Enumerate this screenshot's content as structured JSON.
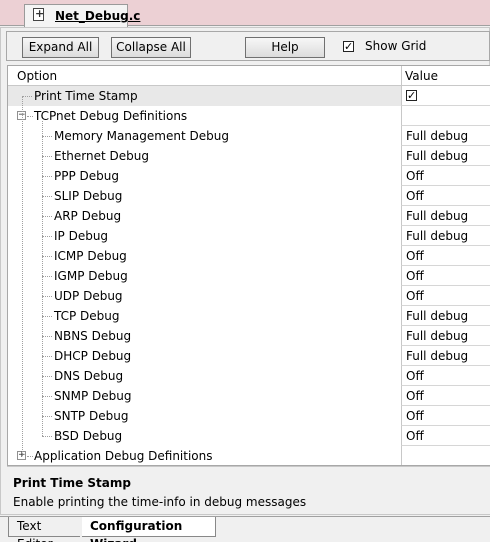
{
  "file_tab": {
    "filename": "Net_Debug.c"
  },
  "toolbar": {
    "expand_all": "Expand All",
    "collapse_all": "Collapse All",
    "help": "Help",
    "show_grid_label": "Show Grid",
    "show_grid_checked": true
  },
  "grid": {
    "columns": {
      "option": "Option",
      "value": "Value"
    },
    "rows": [
      {
        "label": "Print Time Stamp",
        "value": "",
        "checkbox": true,
        "checked": true,
        "level": 0,
        "selected": true
      },
      {
        "label": "TCPnet Debug Definitions",
        "value": "",
        "expander": "-",
        "level": 0
      },
      {
        "label": "Memory Management Debug",
        "value": "Full debug",
        "level": 1
      },
      {
        "label": "Ethernet Debug",
        "value": "Full debug",
        "level": 1
      },
      {
        "label": "PPP Debug",
        "value": "Off",
        "level": 1
      },
      {
        "label": "SLIP Debug",
        "value": "Off",
        "level": 1
      },
      {
        "label": "ARP Debug",
        "value": "Full debug",
        "level": 1
      },
      {
        "label": "IP Debug",
        "value": "Full debug",
        "level": 1
      },
      {
        "label": "ICMP Debug",
        "value": "Off",
        "level": 1
      },
      {
        "label": "IGMP Debug",
        "value": "Off",
        "level": 1
      },
      {
        "label": "UDP Debug",
        "value": "Off",
        "level": 1
      },
      {
        "label": "TCP Debug",
        "value": "Full debug",
        "level": 1
      },
      {
        "label": "NBNS Debug",
        "value": "Full debug",
        "level": 1
      },
      {
        "label": "DHCP Debug",
        "value": "Full debug",
        "level": 1
      },
      {
        "label": "DNS Debug",
        "value": "Off",
        "level": 1
      },
      {
        "label": "SNMP Debug",
        "value": "Off",
        "level": 1
      },
      {
        "label": "SNTP Debug",
        "value": "Off",
        "level": 1
      },
      {
        "label": "BSD Debug",
        "value": "Off",
        "level": 1
      },
      {
        "label": "Application Debug Definitions",
        "value": "",
        "expander": "+",
        "level": 0
      }
    ]
  },
  "description": {
    "title": "Print Time Stamp",
    "text": "Enable printing the time-info in debug messages"
  },
  "bottom_tabs": {
    "text_editor": "Text Editor",
    "config_wizard": "Configuration Wizard"
  }
}
